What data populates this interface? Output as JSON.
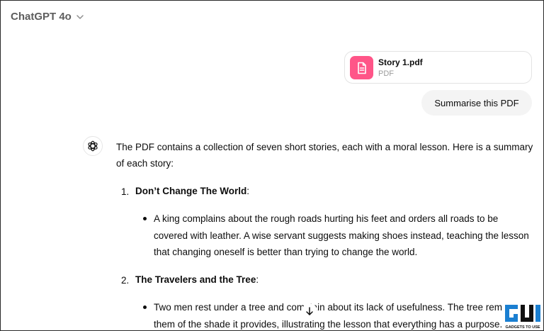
{
  "header": {
    "model_name": "ChatGPT 4o"
  },
  "attachment": {
    "name": "Story 1.pdf",
    "type": "PDF"
  },
  "user_message": "Summarise this PDF",
  "response": {
    "intro": "The PDF contains a collection of seven short stories, each with a moral lesson. Here is a summary of each story:",
    "items": [
      {
        "number": "1.",
        "title": "Don’t Change The World",
        "suffix": ":",
        "bullet": "A king complains about the rough roads hurting his feet and orders all roads to be covered with leather. A wise servant suggests making shoes instead, teaching the lesson that changing oneself is better than trying to change the world."
      },
      {
        "number": "2.",
        "title": "The Travelers and the Tree",
        "suffix": ":",
        "bullet": "Two men rest under a tree and complain about its lack of usefulness. The tree reminds them of the shade it provides, illustrating the lesson that everything has a purpose."
      }
    ]
  },
  "icons": {
    "model_chevron": "chevron-down-icon",
    "file": "document-icon",
    "assistant": "openai-logo-icon",
    "scroll": "arrow-down-icon"
  },
  "watermark": {
    "text": "GADGETS TO USE"
  },
  "colors": {
    "file_icon_bg": "#ff5588",
    "user_bubble_bg": "#f4f4f4",
    "muted": "#5d5d5d"
  }
}
